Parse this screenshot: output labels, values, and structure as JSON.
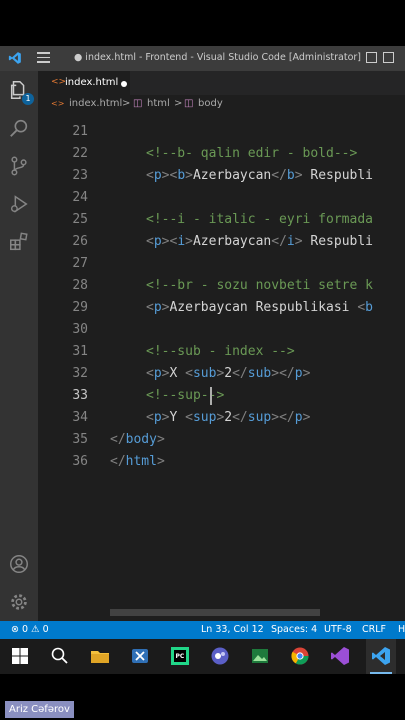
{
  "window": {
    "title": "● index.html - Frontend - Visual Studio Code [Administrator]"
  },
  "activity": {
    "explorer_badge": "1"
  },
  "tab": {
    "label": "index.html"
  },
  "breadcrumb": {
    "file": "index.html",
    "sep1": ">",
    "html": "html",
    "sep2": ">",
    "body": "body"
  },
  "editor": {
    "lines": [
      {
        "num": "21",
        "text": ""
      },
      {
        "num": "22",
        "text": "<!--b- qalin edir - bold-->"
      },
      {
        "num": "23",
        "text": "<p><b>Azerbaycan</b> Respubli"
      },
      {
        "num": "24",
        "text": ""
      },
      {
        "num": "25",
        "text": "<!--i - italic - eyri formada"
      },
      {
        "num": "26",
        "text": "<p><i>Azerbaycan</i> Respubli"
      },
      {
        "num": "27",
        "text": ""
      },
      {
        "num": "28",
        "text": "<!--br - sozu novbeti setre k"
      },
      {
        "num": "29",
        "text": "<p>Azerbaycan Respublikasi <b"
      },
      {
        "num": "30",
        "text": ""
      },
      {
        "num": "31",
        "text": "<!--sub - index -->"
      },
      {
        "num": "32",
        "text": "<p>X <sub>2</sub></p>"
      },
      {
        "num": "33",
        "text": "<!--sup-->"
      },
      {
        "num": "34",
        "text": "<p>Y <sup>2</sup></p>"
      },
      {
        "num": "35",
        "text": "</body>"
      },
      {
        "num": "36",
        "text": "</html>"
      }
    ]
  },
  "status": {
    "errors": "0",
    "warnings": "0",
    "position": "Ln 33, Col 12",
    "spaces": "Spaces: 4",
    "encoding": "UTF-8",
    "eol": "CRLF",
    "language": "H"
  },
  "author": {
    "name": "Ariz Cəfərov"
  },
  "colors": {
    "accent": "#007acc",
    "comment": "#6a9955",
    "tag": "#569cd6",
    "text": "#d4d4d4"
  }
}
